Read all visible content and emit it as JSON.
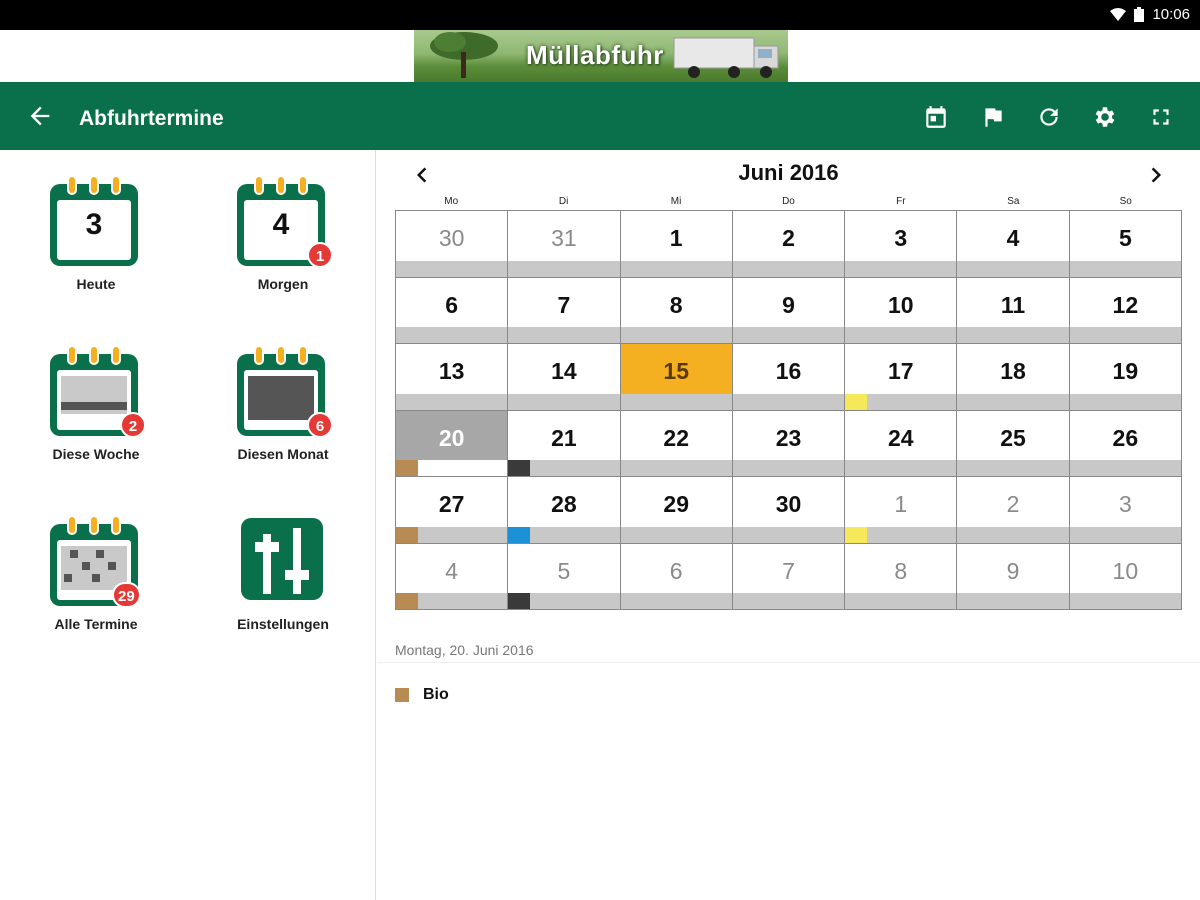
{
  "status_bar": {
    "time": "10:06"
  },
  "banner": {
    "title": "Müllabfuhr"
  },
  "toolbar": {
    "title": "Abfuhrtermine"
  },
  "tiles": [
    {
      "label": "Heute",
      "day": "3",
      "badge": ""
    },
    {
      "label": "Morgen",
      "day": "4",
      "badge": "1"
    },
    {
      "label": "Diese Woche",
      "badge": "2"
    },
    {
      "label": "Diesen Monat",
      "badge": "6"
    },
    {
      "label": "Alle Termine",
      "badge": "29"
    },
    {
      "label": "Einstellungen"
    }
  ],
  "calendar": {
    "month_label": "Juni 2016",
    "weekdays": [
      "Mo",
      "Di",
      "Mi",
      "Do",
      "Fr",
      "Sa",
      "So"
    ],
    "weeks": [
      [
        "30",
        "31",
        "1",
        "2",
        "3",
        "4",
        "5"
      ],
      [
        "6",
        "7",
        "8",
        "9",
        "10",
        "11",
        "12"
      ],
      [
        "13",
        "14",
        "15",
        "16",
        "17",
        "18",
        "19"
      ],
      [
        "20",
        "21",
        "22",
        "23",
        "24",
        "25",
        "26"
      ],
      [
        "27",
        "28",
        "29",
        "30",
        "1",
        "2",
        "3"
      ],
      [
        "4",
        "5",
        "6",
        "7",
        "8",
        "9",
        "10"
      ]
    ],
    "today": "15",
    "selected": "20"
  },
  "detail": {
    "date": "Montag, 20. Juni 2016",
    "items": [
      {
        "label": "Bio",
        "color": "#b98b54"
      }
    ]
  },
  "colors": {
    "toolbar": "#09704b",
    "bio": "#b98b54",
    "rest": "#3a3a3a",
    "gelb": "#f5e85a",
    "papier": "#1e90d8",
    "today": "#f4b020"
  }
}
